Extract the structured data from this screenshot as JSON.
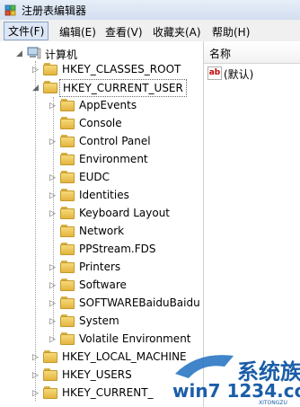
{
  "window": {
    "title": "注册表编辑器"
  },
  "menu": [
    {
      "label": "文件(F)"
    },
    {
      "label": "编辑(E)"
    },
    {
      "label": "查看(V)"
    },
    {
      "label": "收藏夹(A)"
    },
    {
      "label": "帮助(H)"
    }
  ],
  "tree": {
    "root": "计算机",
    "hives": [
      {
        "label": "HKEY_CLASSES_ROOT"
      },
      {
        "label": "HKEY_CURRENT_USER"
      },
      {
        "label": "HKEY_LOCAL_MACHINE"
      },
      {
        "label": "HKEY_USERS"
      },
      {
        "label": "HKEY_CURRENT_"
      }
    ],
    "children": [
      {
        "label": "AppEvents"
      },
      {
        "label": "Console"
      },
      {
        "label": "Control Panel"
      },
      {
        "label": "Environment"
      },
      {
        "label": "EUDC"
      },
      {
        "label": "Identities"
      },
      {
        "label": "Keyboard Layout"
      },
      {
        "label": "Network"
      },
      {
        "label": "PPStream.FDS"
      },
      {
        "label": "Printers"
      },
      {
        "label": "Software"
      },
      {
        "label": "SOFTWAREBaiduBaidu"
      },
      {
        "label": "System"
      },
      {
        "label": "Volatile Environment"
      }
    ]
  },
  "values_pane": {
    "column_name": "名称",
    "rows": [
      {
        "name": "(默认)",
        "type_icon": "ab"
      }
    ]
  },
  "watermark": {
    "brand": "系统族",
    "site": "win7 1234.com",
    "sub": "XITONGZU"
  }
}
